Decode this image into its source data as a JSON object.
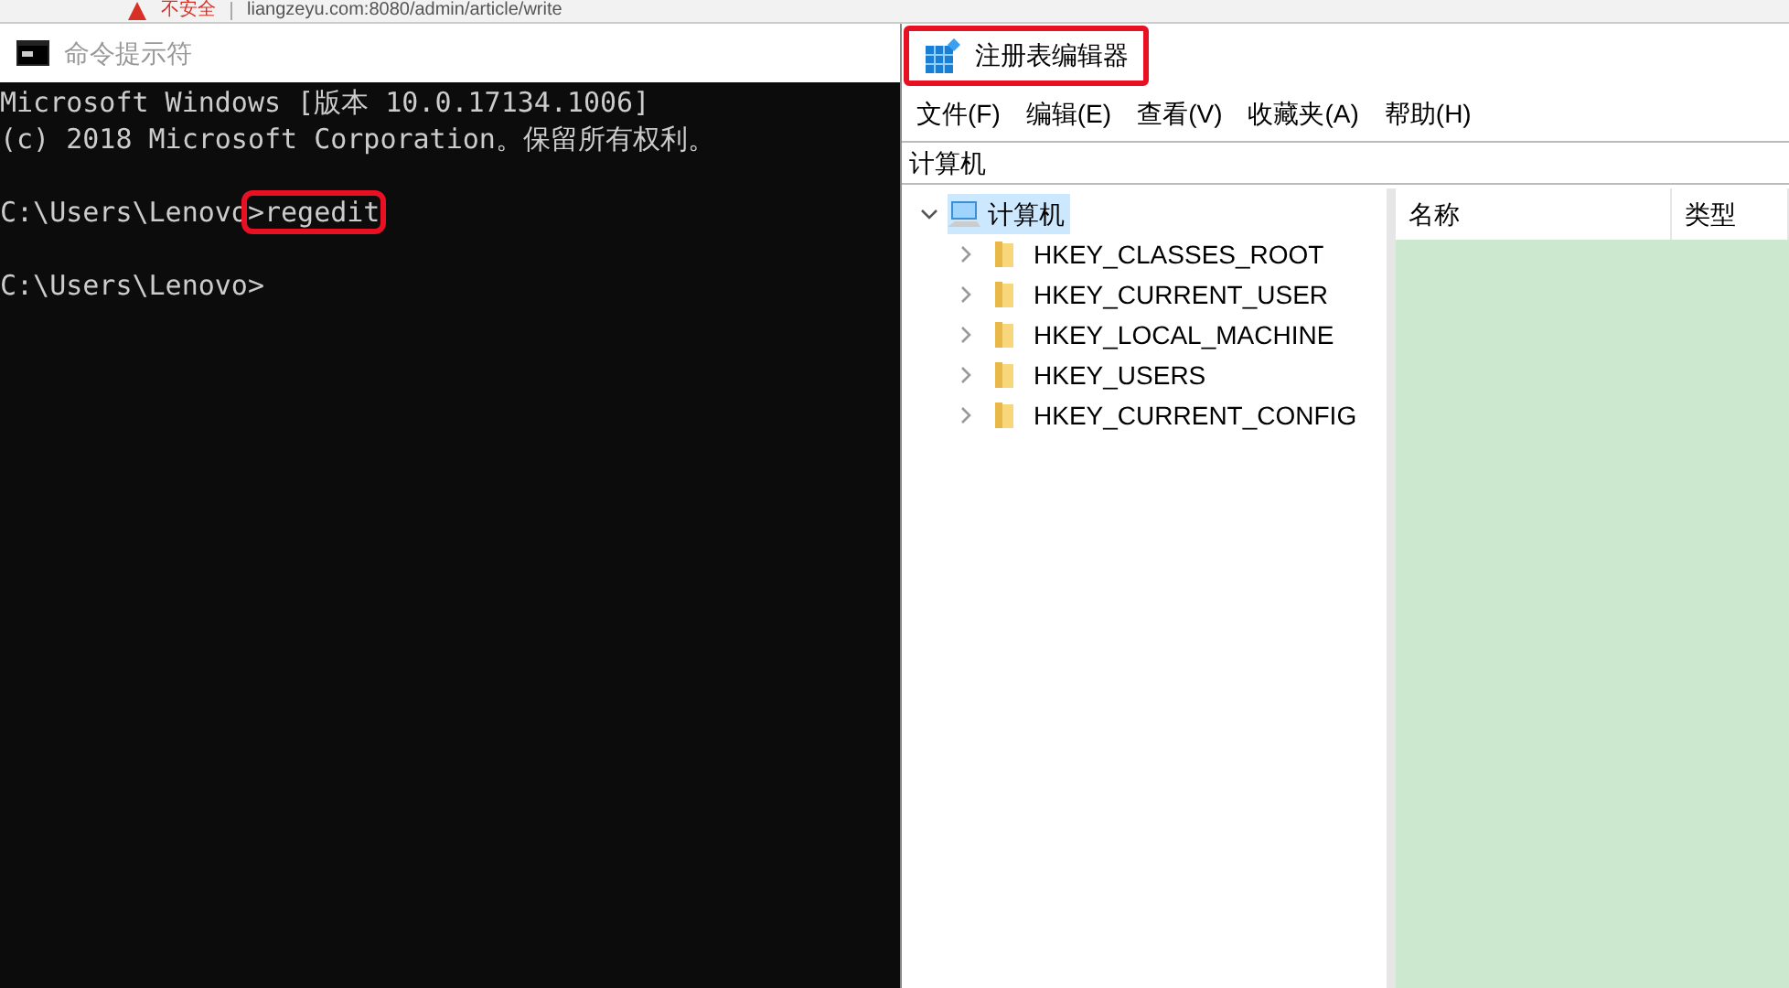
{
  "browser_strip": {
    "security": "不安全",
    "url": "liangzeyu.com:8080/admin/article/write"
  },
  "console_window": {
    "title": "命令提示符",
    "lines": [
      {
        "kind": "text",
        "text": "Microsoft Windows [版本 10.0.17134.1006]"
      },
      {
        "kind": "text",
        "text": "(c) 2018 Microsoft Corporation。保留所有权利。"
      },
      {
        "kind": "blank"
      },
      {
        "kind": "text",
        "text": "C:\\Users\\Lenovo",
        "command": ">regedit",
        "highlighted": true
      },
      {
        "kind": "blank"
      },
      {
        "kind": "text",
        "text": "C:\\Users\\Lenovo>"
      }
    ]
  },
  "regedit_window": {
    "title": "注册表编辑器",
    "title_highlighted": true,
    "menu": [
      "文件(F)",
      "编辑(E)",
      "查看(V)",
      "收藏夹(A)",
      "帮助(H)"
    ],
    "address": "计算机",
    "tree": {
      "label": "计算机",
      "expanded": true,
      "selected": true,
      "children": [
        {
          "label": "HKEY_CLASSES_ROOT",
          "expanded": false
        },
        {
          "label": "HKEY_CURRENT_USER",
          "expanded": false
        },
        {
          "label": "HKEY_LOCAL_MACHINE",
          "expanded": false
        },
        {
          "label": "HKEY_USERS",
          "expanded": false
        },
        {
          "label": "HKEY_CURRENT_CONFIG",
          "expanded": false
        }
      ]
    },
    "columns": [
      "名称",
      "类型"
    ]
  }
}
